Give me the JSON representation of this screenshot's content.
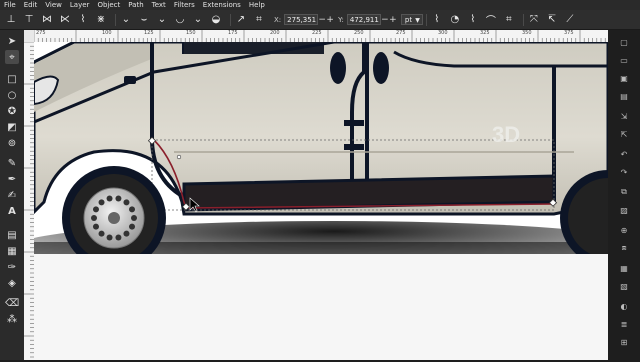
{
  "menu": [
    "File",
    "Edit",
    "View",
    "Layer",
    "Object",
    "Path",
    "Text",
    "Filters",
    "Extensions",
    "Help"
  ],
  "tool_controls": {
    "x_label": "X:",
    "x_value": "275,351",
    "y_label": "Y:",
    "y_value": "472,911",
    "unit": "pt",
    "stepper_minus": "−",
    "stepper_plus": "+"
  },
  "ruler": {
    "labels": [
      "275",
      "100",
      "125",
      "150",
      "175",
      "200",
      "225",
      "250",
      "275",
      "300",
      "325",
      "350",
      "375"
    ]
  },
  "icons": {
    "toolbox": [
      "selector-icon",
      "node-editor-icon",
      "rectangle-icon",
      "ellipse-icon",
      "star-icon",
      "3d-box-icon",
      "spiral-icon",
      "pencil-icon",
      "pen-icon",
      "calligraphy-icon",
      "text-icon",
      "gradient-icon",
      "mesh-icon",
      "dropper-icon",
      "paint-bucket-icon",
      "eraser-icon",
      "spray-icon"
    ]
  },
  "colors": {
    "app_bg": "#1e1e1e",
    "van_body": "#d9d6cc",
    "outline": "#0d1526",
    "path_highlight": "#8a1f2b",
    "tire": "#222222"
  }
}
